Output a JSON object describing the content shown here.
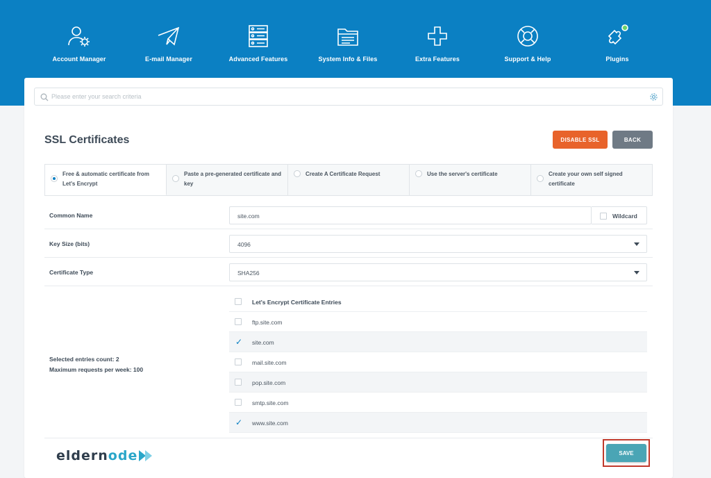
{
  "nav": {
    "items": [
      {
        "label": "Account Manager",
        "icon": "account-manager-icon"
      },
      {
        "label": "E-mail Manager",
        "icon": "paper-plane-icon"
      },
      {
        "label": "Advanced Features",
        "icon": "server-stack-icon"
      },
      {
        "label": "System Info & Files",
        "icon": "folder-icon"
      },
      {
        "label": "Extra Features",
        "icon": "plus-icon"
      },
      {
        "label": "Support & Help",
        "icon": "lifebuoy-icon"
      },
      {
        "label": "Plugins",
        "icon": "puzzle-icon"
      }
    ]
  },
  "search": {
    "placeholder": "Please enter your search criteria"
  },
  "page": {
    "title": "SSL Certificates"
  },
  "buttons": {
    "disable_ssl": "DISABLE SSL",
    "back": "BACK",
    "save": "SAVE"
  },
  "tabs": [
    {
      "label": "Free & automatic certificate from Let's Encrypt",
      "selected": true
    },
    {
      "label": "Paste a pre-generated certificate and key",
      "selected": false
    },
    {
      "label": "Create A Certificate Request",
      "selected": false
    },
    {
      "label": "Use the server's certificate",
      "selected": false
    },
    {
      "label": "Create your own self signed certificate",
      "selected": false
    }
  ],
  "form": {
    "common_name": {
      "label": "Common Name",
      "value": "site.com",
      "wildcard_label": "Wildcard",
      "wildcard_checked": false
    },
    "key_size": {
      "label": "Key Size (bits)",
      "value": "4096"
    },
    "certificate_type": {
      "label": "Certificate Type",
      "value": "SHA256"
    }
  },
  "entries": {
    "header": "Let's Encrypt Certificate Entries",
    "items": [
      {
        "name": "ftp.site.com",
        "checked": false
      },
      {
        "name": "site.com",
        "checked": true
      },
      {
        "name": "mail.site.com",
        "checked": false
      },
      {
        "name": "pop.site.com",
        "checked": false
      },
      {
        "name": "smtp.site.com",
        "checked": false
      },
      {
        "name": "www.site.com",
        "checked": true
      }
    ]
  },
  "stats": {
    "selected_count": "Selected entries count: 2",
    "max_requests": "Maximum requests per week: 100"
  },
  "watermark": {
    "part1": "eldern",
    "part2": "ode"
  },
  "colors": {
    "topbar": "#0b80c3",
    "disable": "#e8632b",
    "back": "#6f7a85",
    "save": "#4aa5b5"
  }
}
